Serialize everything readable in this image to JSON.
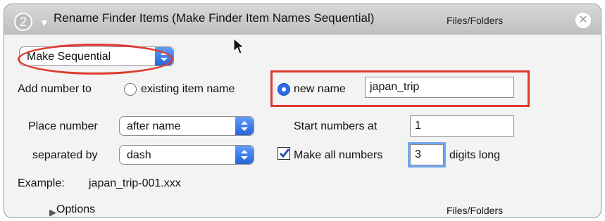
{
  "header": {
    "step_number": "2",
    "title": "Rename Finder Items (Make Finder Item Names Sequential)",
    "category": "Files/Folders",
    "close_icon": "close-icon",
    "disclosure_icon": "disclosure-triangle-down-icon"
  },
  "mode_popup": {
    "selected": "Make Sequential"
  },
  "add_number": {
    "label": "Add number to",
    "option_existing": "existing item name",
    "option_new": "new name",
    "new_name_value": "japan_trip",
    "selected": "new name"
  },
  "place_number": {
    "label": "Place number",
    "selected": "after name"
  },
  "separated_by": {
    "label": "separated by",
    "selected": "dash"
  },
  "start_numbers": {
    "label": "Start numbers at",
    "value": "1"
  },
  "digits": {
    "checkbox_label": "Make all numbers",
    "value": "3",
    "suffix": "digits long",
    "checked": true
  },
  "example": {
    "label": "Example:",
    "value": "japan_trip-001.xxx"
  },
  "footer": {
    "options_label": "Options",
    "category": "Files/Folders"
  },
  "colors": {
    "annotation_red": "#e03a2f",
    "accent_blue": "#2e6be8"
  }
}
